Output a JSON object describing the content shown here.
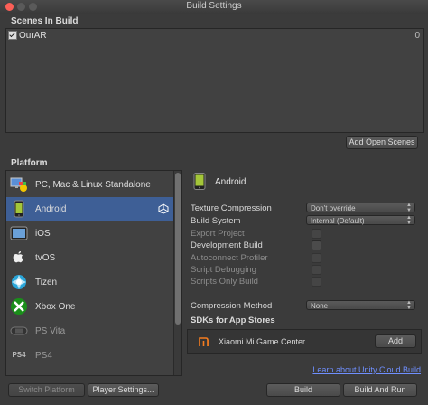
{
  "window": {
    "title": "Build Settings"
  },
  "scenes": {
    "header": "Scenes In Build",
    "items": [
      {
        "name": "OurAR",
        "index": "0",
        "checked": true
      }
    ],
    "add_open_scenes_label": "Add Open Scenes"
  },
  "platform": {
    "header": "Platform",
    "items": [
      {
        "label": "PC, Mac & Linux Standalone",
        "icon": "pc-mac-linux-icon",
        "selected": false,
        "dim": false
      },
      {
        "label": "Android",
        "icon": "android-icon",
        "selected": true,
        "dim": false
      },
      {
        "label": "iOS",
        "icon": "ios-icon",
        "selected": false,
        "dim": false
      },
      {
        "label": "tvOS",
        "icon": "apple-tv-icon",
        "selected": false,
        "dim": false
      },
      {
        "label": "Tizen",
        "icon": "tizen-icon",
        "selected": false,
        "dim": false
      },
      {
        "label": "Xbox One",
        "icon": "xbox-icon",
        "selected": false,
        "dim": false
      },
      {
        "label": "PS Vita",
        "icon": "ps-vita-icon",
        "selected": false,
        "dim": true
      },
      {
        "label": "PS4",
        "icon": "ps4-icon",
        "selected": false,
        "dim": true
      }
    ]
  },
  "settings": {
    "platform_title": "Android",
    "texture_compression": {
      "label": "Texture Compression",
      "value": "Don't override"
    },
    "build_system": {
      "label": "Build System",
      "value": "Internal (Default)"
    },
    "export_project": {
      "label": "Export Project"
    },
    "development_build": {
      "label": "Development Build"
    },
    "autoconnect_profiler": {
      "label": "Autoconnect Profiler"
    },
    "script_debugging": {
      "label": "Script Debugging"
    },
    "scripts_only_build": {
      "label": "Scripts Only Build"
    },
    "compression_method": {
      "label": "Compression Method",
      "value": "None"
    },
    "sdks_title": "SDKs for App Stores",
    "sdk_item": {
      "name": "Xiaomi Mi Game Center",
      "add_label": "Add"
    },
    "cloud_build_link": "Learn about Unity Cloud Build"
  },
  "footer": {
    "switch_platform_label": "Switch Platform",
    "player_settings_label": "Player Settings...",
    "build_label": "Build",
    "build_and_run_label": "Build And Run"
  },
  "colors": {
    "selection": "#3e5f96",
    "link": "#6f8fff",
    "mi_orange": "#f57c1f"
  }
}
